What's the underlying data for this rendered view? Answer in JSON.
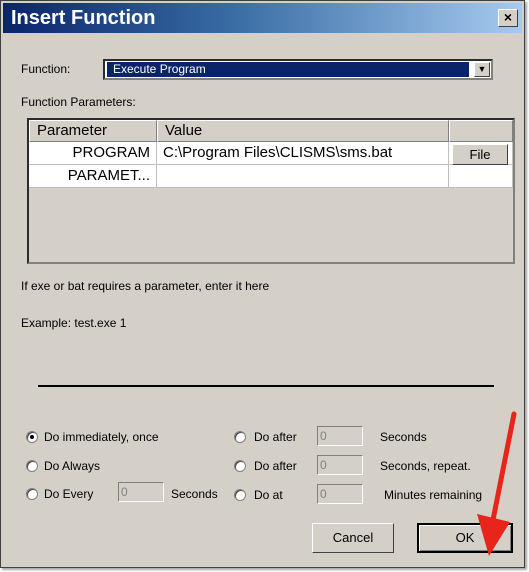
{
  "window": {
    "title": "Insert Function",
    "close_glyph": "×"
  },
  "function": {
    "label": "Function:",
    "value": "Execute Program"
  },
  "params": {
    "label": "Function Parameters:",
    "columns": [
      "Parameter",
      "Value"
    ],
    "rows": [
      {
        "parameter": "PROGRAM",
        "value": "C:\\Program Files\\CLISMS\\sms.bat",
        "button": "File"
      },
      {
        "parameter": "PARAMET...",
        "value": ""
      }
    ]
  },
  "hint": "If exe or bat requires a parameter, enter it here",
  "example": "Example: test.exe 1",
  "schedule": {
    "do_immediately": "Do immediately, once",
    "do_always": "Do Always",
    "do_every": "Do Every",
    "do_every_value": "0",
    "do_every_unit": "Seconds",
    "do_after_1": "Do after",
    "do_after_1_value": "0",
    "do_after_1_unit": "Seconds",
    "do_after_2": "Do after",
    "do_after_2_value": "0",
    "do_after_2_unit": "Seconds, repeat.",
    "do_at": "Do at",
    "do_at_value": "0",
    "do_at_unit": "Minutes remaining"
  },
  "buttons": {
    "cancel": "Cancel",
    "ok": "OK"
  },
  "colors": {
    "title_bar": "#0a246a",
    "selection": "#0a246a",
    "face": "#d4d0c8",
    "annotation_arrow": "#e8241b"
  }
}
